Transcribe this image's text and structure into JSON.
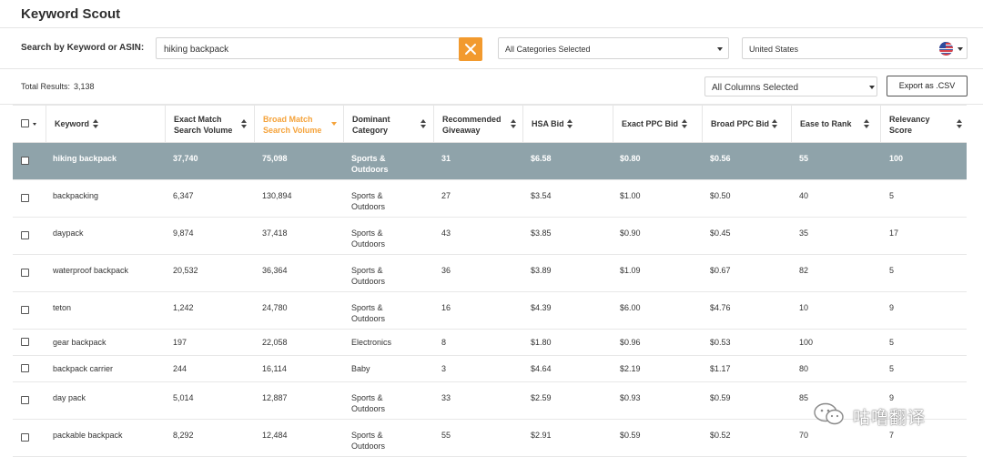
{
  "app": {
    "title": "Keyword Scout"
  },
  "search": {
    "label": "Search by Keyword or ASIN:",
    "value": "hiking backpack",
    "clear_icon": "close-icon"
  },
  "category_select": {
    "value": "All Categories Selected"
  },
  "country_select": {
    "value": "United States",
    "flag_icon": "us-flag-icon"
  },
  "results": {
    "label": "Total Results:",
    "count": "3,138"
  },
  "columns_select": {
    "value": "All Columns Selected"
  },
  "export_label": "Export as .CSV",
  "accent_color": "#f29a2e",
  "selected_row_color": "#8fa3aa",
  "table": {
    "headers": [
      "Keyword",
      "Exact Match Search Volume",
      "Broad Match Search Volume",
      "Dominant Category",
      "Recommended Giveaway",
      "HSA Bid",
      "Exact PPC Bid",
      "Broad PPC Bid",
      "Ease to Rank",
      "Relevancy Score"
    ],
    "active_sort_column": "Broad Match Search Volume",
    "rows": [
      [
        "hiking backpack",
        "37,740",
        "75,098",
        "Sports & Outdoors",
        "31",
        "$6.58",
        "$0.80",
        "$0.56",
        "55",
        "100"
      ],
      [
        "backpacking",
        "6,347",
        "130,894",
        "Sports & Outdoors",
        "27",
        "$3.54",
        "$1.00",
        "$0.50",
        "40",
        "5"
      ],
      [
        "daypack",
        "9,874",
        "37,418",
        "Sports & Outdoors",
        "43",
        "$3.85",
        "$0.90",
        "$0.45",
        "35",
        "17"
      ],
      [
        "waterproof backpack",
        "20,532",
        "36,364",
        "Sports & Outdoors",
        "36",
        "$3.89",
        "$1.09",
        "$0.67",
        "82",
        "5"
      ],
      [
        "teton",
        "1,242",
        "24,780",
        "Sports & Outdoors",
        "16",
        "$4.39",
        "$6.00",
        "$4.76",
        "10",
        "9"
      ],
      [
        "gear backpack",
        "197",
        "22,058",
        "Electronics",
        "8",
        "$1.80",
        "$0.96",
        "$0.53",
        "100",
        "5"
      ],
      [
        "backpack carrier",
        "244",
        "16,114",
        "Baby",
        "3",
        "$4.64",
        "$2.19",
        "$1.17",
        "80",
        "5"
      ],
      [
        "day pack",
        "5,014",
        "12,887",
        "Sports & Outdoors",
        "33",
        "$2.59",
        "$0.93",
        "$0.59",
        "85",
        "9"
      ],
      [
        "packable backpack",
        "8,292",
        "12,484",
        "Sports & Outdoors",
        "55",
        "$2.91",
        "$0.59",
        "$0.52",
        "70",
        "7"
      ]
    ]
  },
  "watermark": {
    "text": "咕噜翻译",
    "icon": "wechat-icon"
  }
}
